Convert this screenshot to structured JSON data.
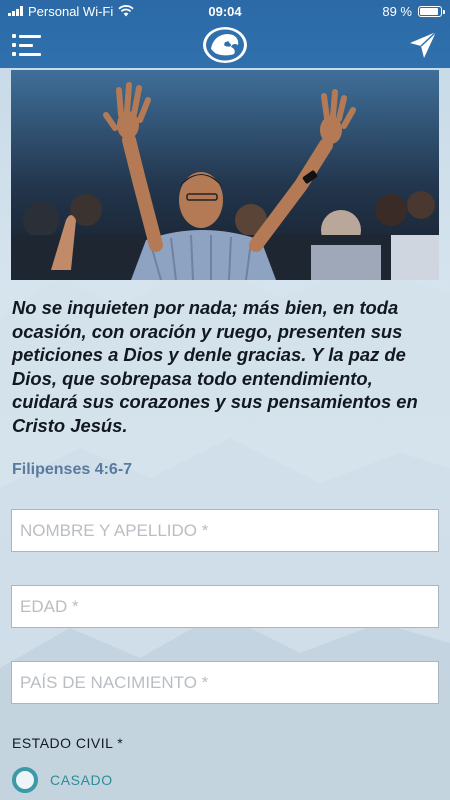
{
  "status_bar": {
    "carrier": "Personal Wi-Fi",
    "time": "09:04",
    "battery": "89 %",
    "battery_level": 0.89
  },
  "nav": {
    "menu_icon": "menu-icon",
    "logo_icon": "lion-logo-icon",
    "send_icon": "send-arrow-icon"
  },
  "main": {
    "verse": "No se inquieten por nada; más bien, en toda ocasión, con oración y ruego, presenten sus peticiones a Dios y denle gracias. Y la paz de Dios, que sobrepasa todo entendimiento, cuidará sus corazones y sus pensamientos en Cristo Jesús.",
    "reference": "Filipenses 4:6-7",
    "fields": {
      "name_placeholder": "NOMBRE Y APELLIDO *",
      "age_placeholder": "EDAD *",
      "country_placeholder": "PAÍS DE NACIMIENTO *"
    },
    "estado_civil": {
      "label": "ESTADO CIVIL *",
      "option_married": "CASADO"
    }
  },
  "colors": {
    "header_blue": "#2f70ad",
    "reference_blue": "#5a7a9e",
    "radio_teal": "#3b9aa5"
  }
}
